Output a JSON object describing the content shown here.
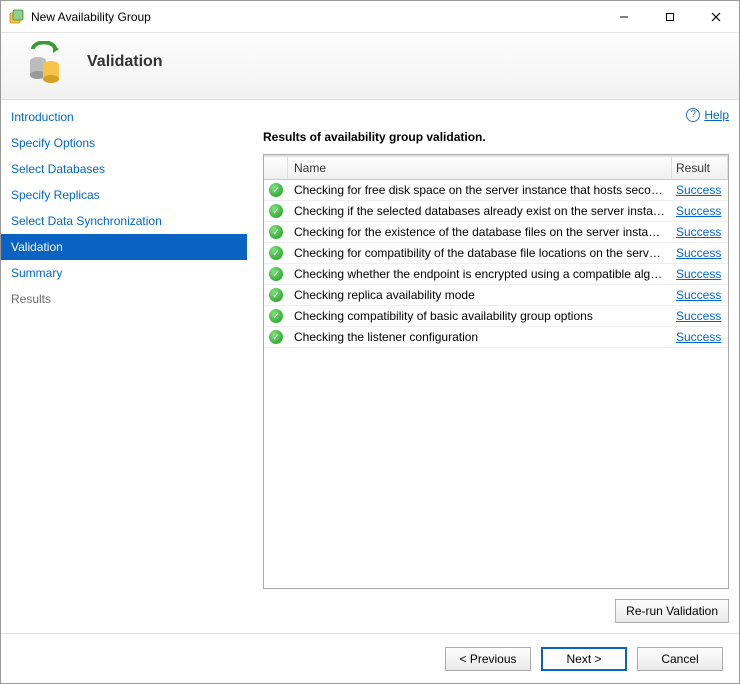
{
  "window": {
    "title": "New Availability Group"
  },
  "header": {
    "title": "Validation"
  },
  "help": {
    "label": "Help"
  },
  "sidebar": {
    "items": [
      {
        "label": "Introduction",
        "state": "link"
      },
      {
        "label": "Specify Options",
        "state": "link"
      },
      {
        "label": "Select Databases",
        "state": "link"
      },
      {
        "label": "Specify Replicas",
        "state": "link"
      },
      {
        "label": "Select Data Synchronization",
        "state": "link"
      },
      {
        "label": "Validation",
        "state": "active"
      },
      {
        "label": "Summary",
        "state": "link"
      },
      {
        "label": "Results",
        "state": "muted"
      }
    ]
  },
  "main": {
    "subtitle": "Results of availability group validation.",
    "columns": {
      "name": "Name",
      "result": "Result"
    },
    "rows": [
      {
        "name": "Checking for free disk space on the server instance that hosts secondary r...",
        "result": "Success"
      },
      {
        "name": "Checking if the selected databases already exist on the server instance tha...",
        "result": "Success"
      },
      {
        "name": "Checking for the existence of the database files on the server instance tha...",
        "result": "Success"
      },
      {
        "name": "Checking for compatibility of the database file locations on the server inst...",
        "result": "Success"
      },
      {
        "name": "Checking whether the endpoint is encrypted using a compatible algorithm",
        "result": "Success"
      },
      {
        "name": "Checking replica availability mode",
        "result": "Success"
      },
      {
        "name": "Checking compatibility of basic availability group options",
        "result": "Success"
      },
      {
        "name": "Checking the listener configuration",
        "result": "Success"
      }
    ],
    "rerun_label": "Re-run Validation"
  },
  "footer": {
    "previous": "< Previous",
    "next": "Next >",
    "cancel": "Cancel"
  }
}
